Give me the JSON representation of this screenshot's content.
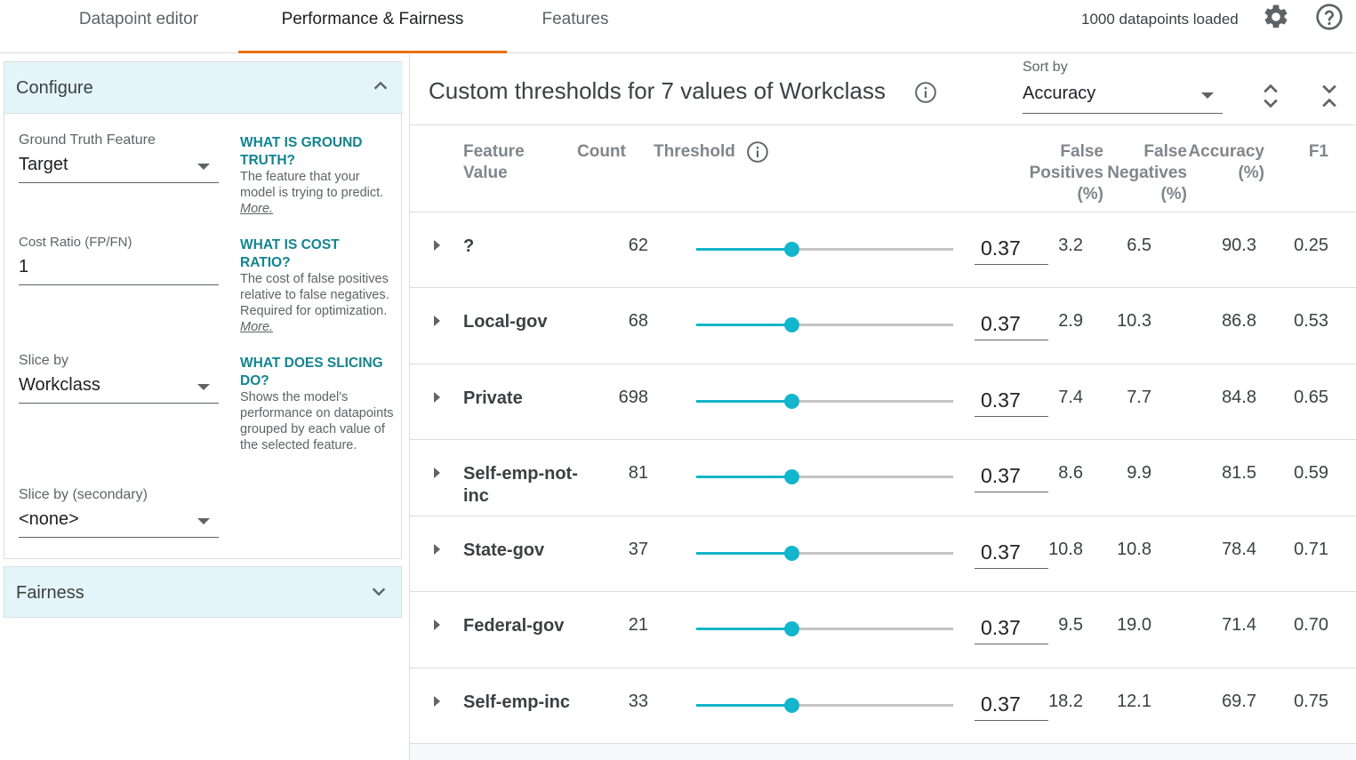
{
  "tabs": [
    {
      "label": "Datapoint editor",
      "active": false
    },
    {
      "label": "Performance & Fairness",
      "active": true
    },
    {
      "label": "Features",
      "active": false
    }
  ],
  "status": {
    "loaded_text": "1000 datapoints loaded",
    "settings_icon": "gear-icon",
    "help_icon": "help-circle-icon"
  },
  "configure": {
    "title": "Configure",
    "ground_truth": {
      "label": "Ground Truth Feature",
      "value": "Target",
      "help_title": "WHAT IS GROUND TRUTH?",
      "help_text": "The feature that your model is trying to predict.",
      "more": "More."
    },
    "cost_ratio": {
      "label": "Cost Ratio (FP/FN)",
      "value": "1",
      "help_title": "WHAT IS COST RATIO?",
      "help_text": "The cost of false positives relative to false negatives. Required for optimization.",
      "more": "More."
    },
    "slice_by": {
      "label": "Slice by",
      "value": "Workclass",
      "help_title": "WHAT DOES SLICING DO?",
      "help_text": "Shows the model's performance on datapoints grouped by each value of the selected feature."
    },
    "slice_by_secondary": {
      "label": "Slice by (secondary)",
      "value": "<none>"
    }
  },
  "fairness": {
    "title": "Fairness"
  },
  "main": {
    "title": "Custom thresholds for 7 values of Workclass",
    "sort_by": {
      "label": "Sort by",
      "value": "Accuracy"
    },
    "columns": {
      "feature_value": "Feature Value",
      "count": "Count",
      "threshold": "Threshold",
      "false_positives": "False Positives (%)",
      "false_negatives": "False Negatives (%)",
      "accuracy": "Accuracy (%)",
      "f1": "F1"
    },
    "rows": [
      {
        "feature": "?",
        "count": "62",
        "threshold": "0.37",
        "fp": "3.2",
        "fn": "6.5",
        "acc": "90.3",
        "f1": "0.25"
      },
      {
        "feature": "Local-gov",
        "count": "68",
        "threshold": "0.37",
        "fp": "2.9",
        "fn": "10.3",
        "acc": "86.8",
        "f1": "0.53"
      },
      {
        "feature": "Private",
        "count": "698",
        "threshold": "0.37",
        "fp": "7.4",
        "fn": "7.7",
        "acc": "84.8",
        "f1": "0.65"
      },
      {
        "feature": "Self-emp-not-inc",
        "count": "81",
        "threshold": "0.37",
        "fp": "8.6",
        "fn": "9.9",
        "acc": "81.5",
        "f1": "0.59"
      },
      {
        "feature": "State-gov",
        "count": "37",
        "threshold": "0.37",
        "fp": "10.8",
        "fn": "10.8",
        "acc": "78.4",
        "f1": "0.71"
      },
      {
        "feature": "Federal-gov",
        "count": "21",
        "threshold": "0.37",
        "fp": "9.5",
        "fn": "19.0",
        "acc": "71.4",
        "f1": "0.70"
      },
      {
        "feature": "Self-emp-inc",
        "count": "33",
        "threshold": "0.37",
        "fp": "18.2",
        "fn": "12.1",
        "acc": "69.7",
        "f1": "0.75"
      }
    ]
  },
  "colors": {
    "accent_tab": "#e8710a",
    "slider": "#12b5cb",
    "help_title": "#12848f",
    "section_bg": "#e4f5f9"
  }
}
